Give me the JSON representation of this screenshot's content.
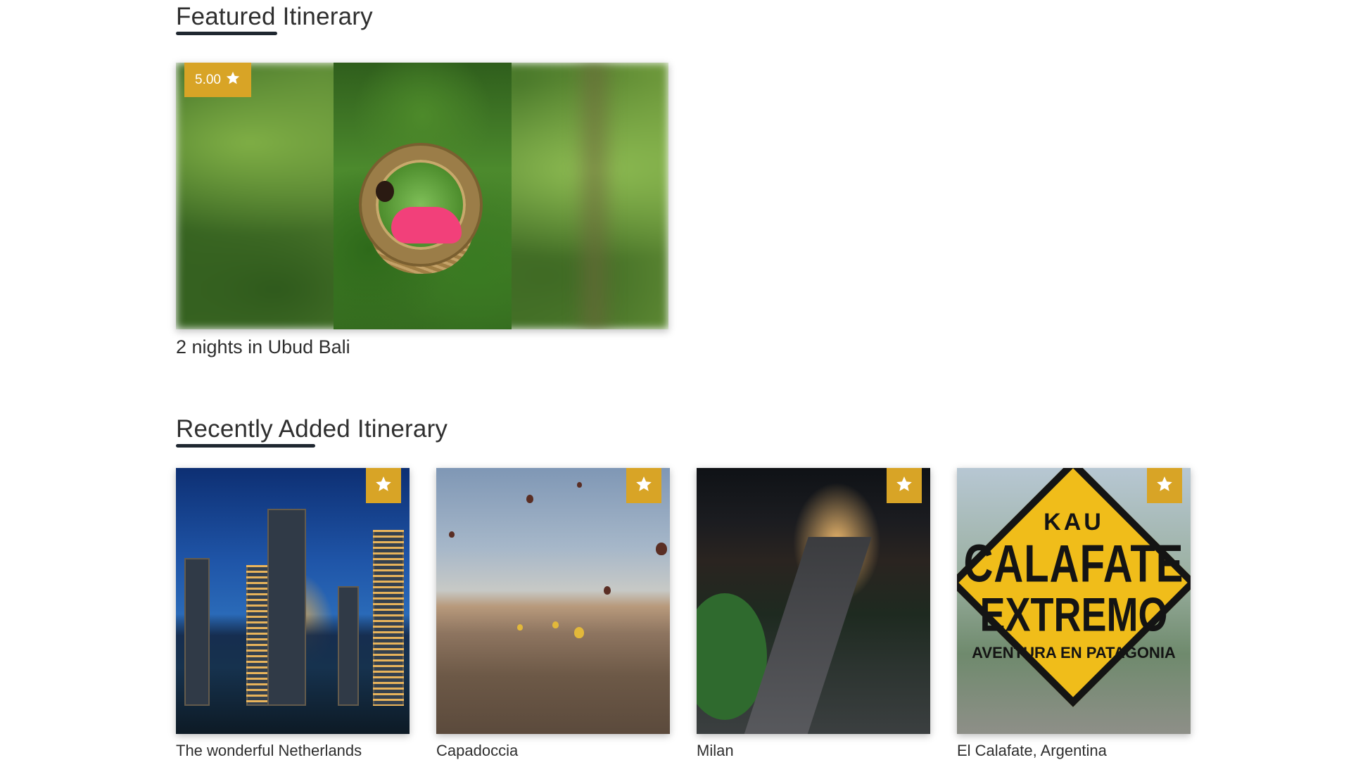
{
  "featured": {
    "title": "Featured Itinerary",
    "card": {
      "rating": "5.00",
      "caption": "2 nights in Ubud Bali"
    }
  },
  "recent": {
    "title": "Recently Added Itinerary",
    "cards": [
      {
        "caption": "The wonderful Netherlands"
      },
      {
        "caption": "Capadoccia"
      },
      {
        "caption": "Milan"
      },
      {
        "caption": "El Calafate, Argentina"
      }
    ]
  },
  "sign": {
    "line1": "KAU",
    "line2": "CALAFATE",
    "line3": "EXTREMO",
    "line4": "AVENTURA EN PATAGONIA"
  },
  "colors": {
    "badge": "#d8a426",
    "heading_underline": "#1f2730",
    "text": "#2e2e2e"
  },
  "icons": [
    "star-icon"
  ]
}
